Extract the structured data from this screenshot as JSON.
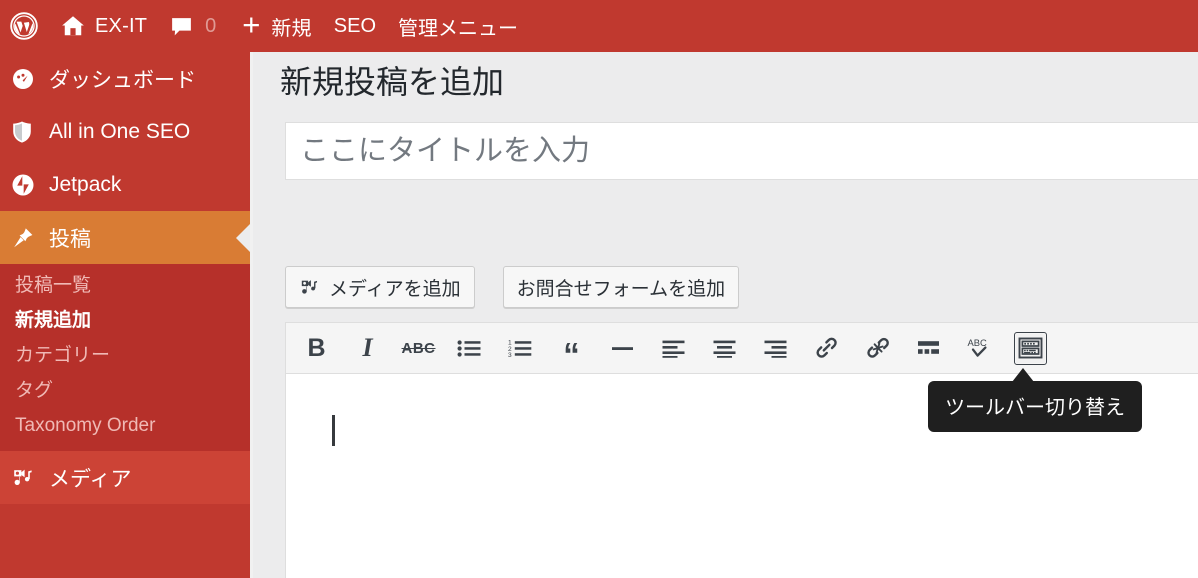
{
  "adminbar": {
    "wp_logo": "wordpress-logo-icon",
    "site": {
      "icon": "home-icon",
      "label": "EX-IT"
    },
    "comments": {
      "icon": "comment-bubble-icon",
      "count": "0"
    },
    "new": {
      "icon": "plus-icon",
      "label": "新規"
    },
    "seo": {
      "label": "SEO"
    },
    "admin_menu": {
      "label": "管理メニュー"
    }
  },
  "sidebar": {
    "items": [
      {
        "icon": "dashboard-gauge-icon",
        "label": "ダッシュボード",
        "state": "default"
      },
      {
        "icon": "shield-icon",
        "label": "All in One SEO",
        "state": "default"
      },
      {
        "icon": "jetpack-icon",
        "label": "Jetpack",
        "state": "default"
      },
      {
        "icon": "pin-icon",
        "label": "投稿",
        "state": "current"
      },
      {
        "icon": "media-icon",
        "label": "メディア",
        "state": "hovered"
      }
    ],
    "submenu": [
      {
        "label": "投稿一覧",
        "state": "default"
      },
      {
        "label": "新規追加",
        "state": "current"
      },
      {
        "label": "カテゴリー",
        "state": "default"
      },
      {
        "label": "タグ",
        "state": "default"
      },
      {
        "label": "Taxonomy Order",
        "state": "default"
      }
    ]
  },
  "main": {
    "page_title": "新規投稿を追加",
    "title_field": {
      "value": "",
      "placeholder": "ここにタイトルを入力"
    },
    "buttons": {
      "add_media": {
        "icon": "media-icon",
        "label": "メディアを追加"
      },
      "add_contact_form": {
        "label": "お問合せフォームを追加"
      }
    },
    "editor": {
      "toolbar": [
        {
          "name": "bold",
          "glyph": "B"
        },
        {
          "name": "italic",
          "glyph": "I"
        },
        {
          "name": "strikethrough",
          "glyph": "ABC"
        },
        {
          "name": "bulleted-list",
          "glyph": ""
        },
        {
          "name": "numbered-list",
          "glyph": ""
        },
        {
          "name": "blockquote",
          "glyph": "“"
        },
        {
          "name": "horizontal-rule",
          "glyph": ""
        },
        {
          "name": "align-left",
          "glyph": ""
        },
        {
          "name": "align-center",
          "glyph": ""
        },
        {
          "name": "align-right",
          "glyph": ""
        },
        {
          "name": "insert-link",
          "glyph": ""
        },
        {
          "name": "remove-link",
          "glyph": ""
        },
        {
          "name": "insert-read-more",
          "glyph": ""
        },
        {
          "name": "spellcheck",
          "glyph": "ABC"
        },
        {
          "name": "toggle-toolbar",
          "glyph": ""
        }
      ],
      "body_text": ""
    },
    "tooltip": {
      "text": "ツールバー切り替え"
    }
  },
  "colors": {
    "admin_red": "#c0392f",
    "submenu_red": "#b6302a",
    "current_orange": "#d97c34",
    "hover_red": "#cc4336",
    "content_bg": "#ececed",
    "toolbar_bg": "#f5f5f5",
    "tooltip_bg": "#1f1f1f",
    "icon_gray": "#3c434a"
  }
}
